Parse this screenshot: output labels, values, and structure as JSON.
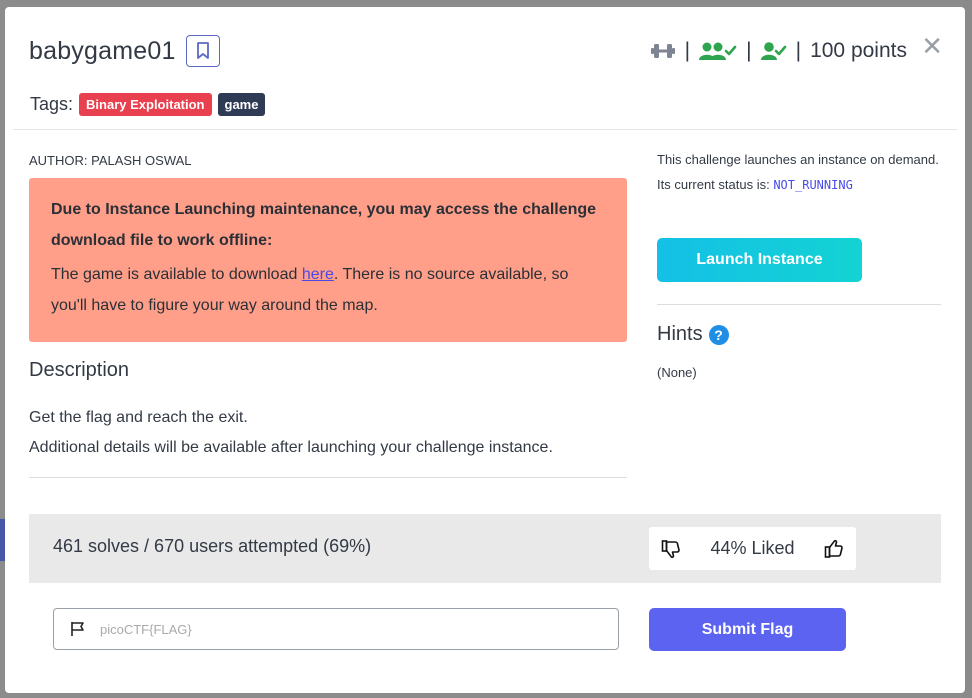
{
  "header": {
    "title": "babygame01",
    "points": "100 points",
    "separator": "|"
  },
  "tags": {
    "label": "Tags:",
    "items": [
      "Binary Exploitation",
      "game"
    ]
  },
  "author": "AUTHOR: PALASH OSWAL",
  "notice": {
    "heading": "Due to Instance Launching maintenance, you may access the challenge download file to work offline:",
    "text_before_link": "The game is available to download ",
    "link_text": "here",
    "text_after_link": ". There is no source available, so you'll have to figure your way around the map."
  },
  "description": {
    "heading": "Description",
    "line1": "Get the flag and reach the exit.",
    "line2": "Additional details will be available after launching your challenge instance."
  },
  "instance": {
    "intro": "This challenge launches an instance on demand.",
    "status_label": "Its current status is: ",
    "status_value": "NOT_RUNNING",
    "launch_label": "Launch Instance"
  },
  "hints": {
    "heading": "Hints",
    "help_glyph": "?",
    "value": "(None)"
  },
  "stats": {
    "solves_text": "461 solves / 670 users attempted (69%)",
    "liked_text": "44% Liked"
  },
  "flag_form": {
    "placeholder": "picoCTF{FLAG}",
    "submit_label": "Submit Flag"
  },
  "colors": {
    "tag_binary": "#e8404e",
    "tag_game": "#2f3a55",
    "notice_bg": "#ff9f89",
    "status_green": "#2ea44f",
    "submit_bg": "#5b63f0",
    "launch_gradient_start": "#14c0e6"
  },
  "icons": [
    "bookmark-icon",
    "dumbbell-icon",
    "users-check-icon",
    "user-check-icon",
    "close-icon",
    "help-icon",
    "thumbs-down-icon",
    "thumbs-up-icon",
    "flag-icon"
  ]
}
